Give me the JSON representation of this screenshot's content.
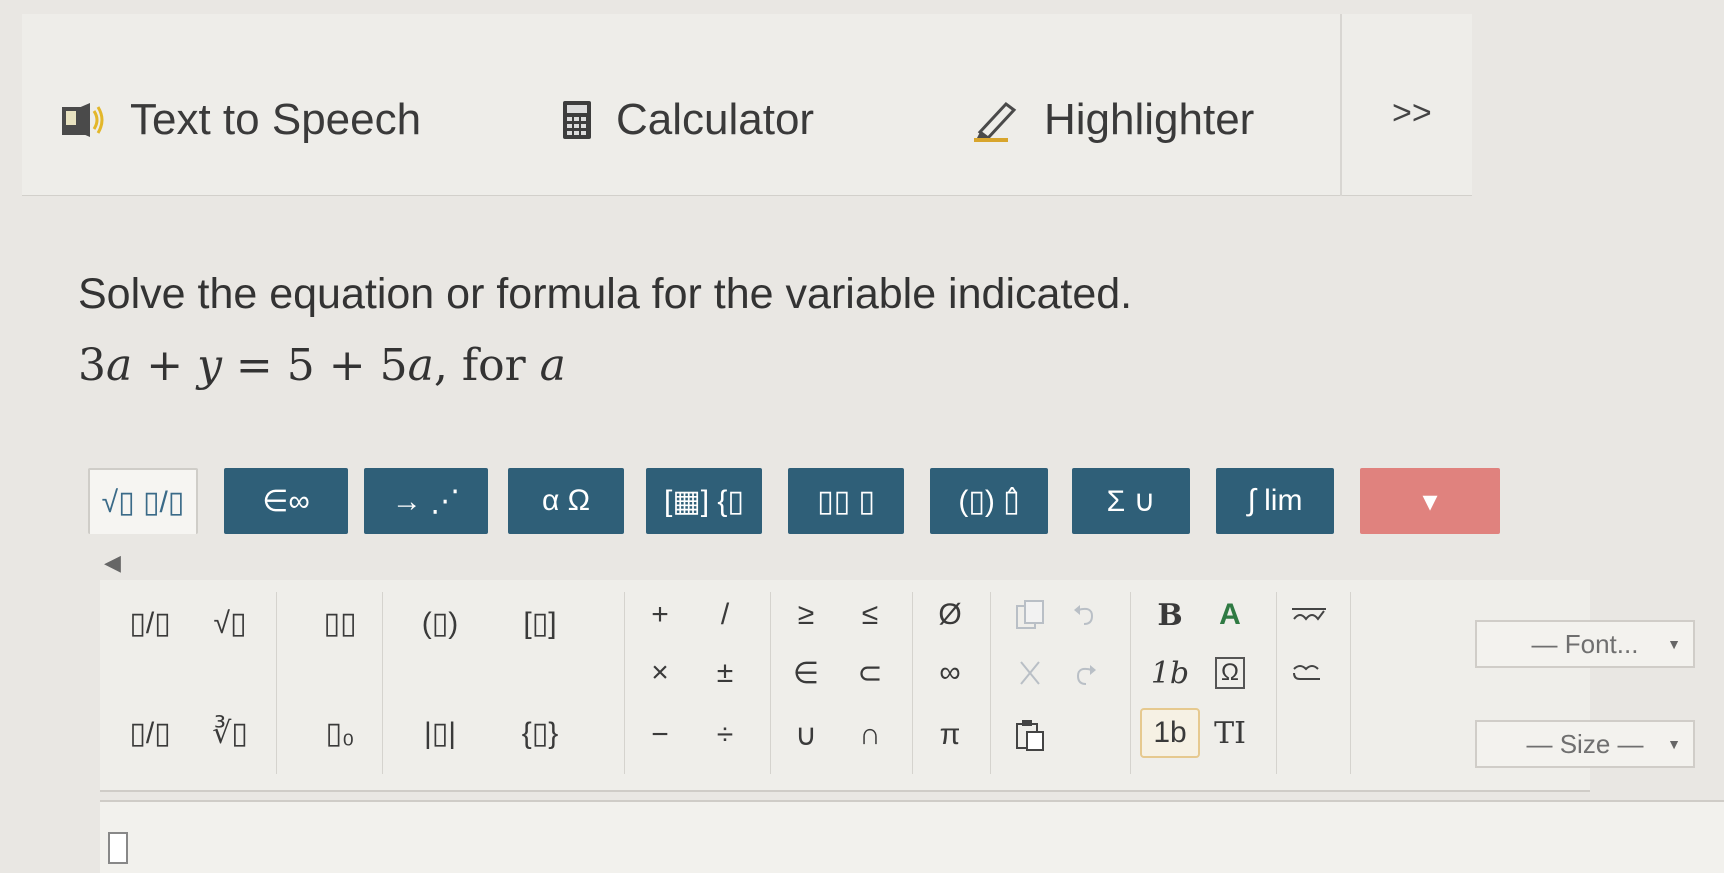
{
  "toolbar": {
    "text_to_speech": "Text to Speech",
    "calculator": "Calculator",
    "highlighter": "Highlighter",
    "more": ">>"
  },
  "question": {
    "instruction": "Solve the equation or formula for the variable indicated.",
    "equation_parts": [
      "3",
      "a",
      " + ",
      "y",
      " = 5 + 5",
      "a",
      ", for ",
      "a"
    ]
  },
  "tabs": [
    {
      "label": "√▯ ▯/▯",
      "active": true
    },
    {
      "label": "∈∞"
    },
    {
      "label": "→ ⋰"
    },
    {
      "label": "α Ω"
    },
    {
      "label": "[▦] {▯"
    },
    {
      "label": "▯▯ ▯"
    },
    {
      "label": "(▯) ▯̂"
    },
    {
      "label": "Σ ∪"
    },
    {
      "label": "∫ lim"
    },
    {
      "label": "▾"
    }
  ],
  "scroll_left": "◀",
  "palette": {
    "structures": [
      "▯/▯",
      "√▯",
      "▯▯",
      "(▯)",
      "[▯]",
      "▯/▯",
      "∛▯",
      "▯₀",
      "|▯|",
      "{▯}"
    ],
    "operators": [
      "+",
      "/",
      "×",
      "±",
      "−",
      "÷"
    ],
    "relations": [
      "≥",
      "≤",
      "∈",
      "⊂",
      "∪",
      "∩"
    ],
    "sets": [
      "Ø",
      "∞",
      "π"
    ],
    "edit": [
      "copy",
      "undo",
      "cut",
      "redo",
      "paste"
    ],
    "format": [
      "B",
      "A",
      "1b",
      "Ω",
      "1b",
      "TI"
    ],
    "font_dropdown": "— Font...",
    "size_dropdown": "— Size —"
  },
  "colors": {
    "tab_bg": "#2f5f78",
    "tab_active_text": "#3a6a88",
    "tab_arrow": "#e0827e",
    "highlight_box": "#e6c98f"
  }
}
